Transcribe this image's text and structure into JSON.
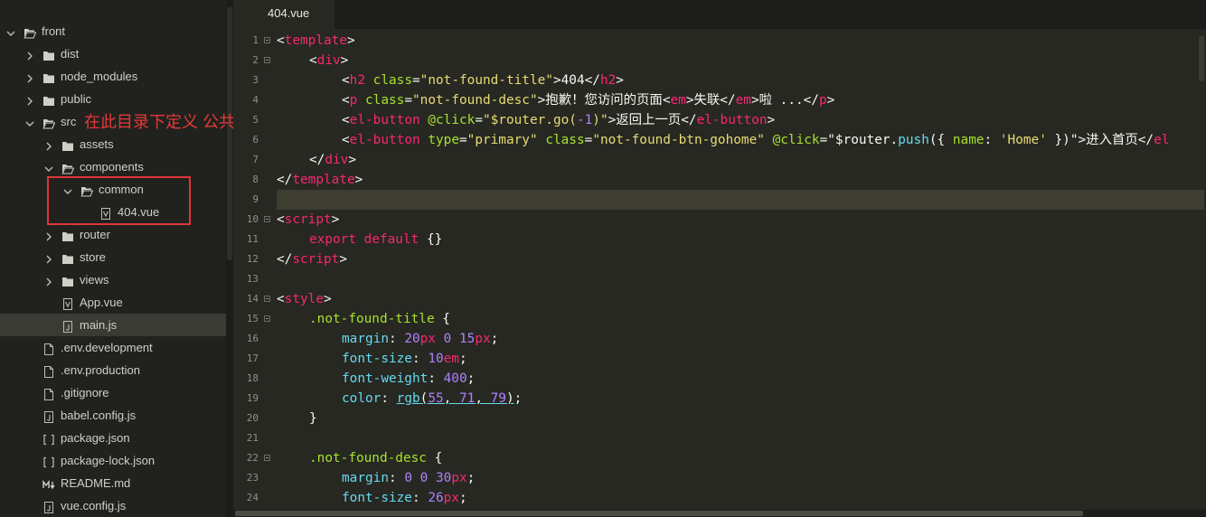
{
  "editor": {
    "tab_label": "404.vue",
    "line_numbers": [
      "1",
      "2",
      "3",
      "4",
      "5",
      "6",
      "7",
      "8",
      "9",
      "10",
      "11",
      "12",
      "13",
      "14",
      "15",
      "16",
      "17",
      "18",
      "19",
      "20",
      "21",
      "22",
      "23",
      "24"
    ]
  },
  "sidebar": {
    "annotation": "在此目录下定义 公共组件",
    "items": [
      {
        "label": "front",
        "icon": "folder-open-icon"
      },
      {
        "label": "dist",
        "icon": "folder-icon"
      },
      {
        "label": "node_modules",
        "icon": "folder-icon"
      },
      {
        "label": "public",
        "icon": "folder-icon"
      },
      {
        "label": "src",
        "icon": "folder-open-icon"
      },
      {
        "label": "assets",
        "icon": "folder-icon"
      },
      {
        "label": "components",
        "icon": "folder-open-icon"
      },
      {
        "label": "common",
        "icon": "folder-open-icon"
      },
      {
        "label": "404.vue",
        "icon": "vue-file-icon"
      },
      {
        "label": "router",
        "icon": "folder-icon"
      },
      {
        "label": "store",
        "icon": "folder-icon"
      },
      {
        "label": "views",
        "icon": "folder-icon"
      },
      {
        "label": "App.vue",
        "icon": "vue-file-icon"
      },
      {
        "label": "main.js",
        "icon": "js-file-icon"
      },
      {
        "label": ".env.development",
        "icon": "file-icon"
      },
      {
        "label": ".env.production",
        "icon": "file-icon"
      },
      {
        "label": ".gitignore",
        "icon": "file-icon"
      },
      {
        "label": "babel.config.js",
        "icon": "js-file-icon"
      },
      {
        "label": "package.json",
        "icon": "json-file-icon"
      },
      {
        "label": "package-lock.json",
        "icon": "json-file-icon"
      },
      {
        "label": "README.md",
        "icon": "markdown-file-icon"
      },
      {
        "label": "vue.config.js",
        "icon": "js-file-icon"
      }
    ]
  },
  "code": {
    "l1": {
      "a": "<",
      "b": "template",
      "c": ">"
    },
    "l2": {
      "a": "<",
      "b": "div",
      "c": ">"
    },
    "l3": {
      "a": "<",
      "b": "h2",
      "c": " ",
      "d": "class",
      "e": "=",
      "f": "\"not-found-title\"",
      "g": ">404</",
      "h": "h2",
      "i": ">"
    },
    "l4": {
      "a": "<",
      "b": "p",
      "c": " ",
      "d": "class",
      "e": "=",
      "f": "\"not-found-desc\"",
      "g": ">抱歉！您访问的页面<",
      "h": "em",
      "i": ">失联</",
      "j": "em",
      "k": ">啦 ...</",
      "l": "p",
      "m": ">"
    },
    "l5": {
      "a": "<",
      "b": "el-button",
      "c": " ",
      "d": "@click",
      "e": "=",
      "f": "\"$router.go(",
      "g": "-1",
      "h": ")\"",
      "i": ">返回上一页</",
      "j": "el-button",
      "k": ">"
    },
    "l6": {
      "a": "<",
      "b": "el-button",
      "c": " ",
      "d": "type",
      "e": "=",
      "f": "\"primary\"",
      "g": " ",
      "h": "class",
      "i": "=",
      "j": "\"not-found-btn-gohome\"",
      "k": " ",
      "l": "@click",
      "m": "=",
      "n": "\"$router.",
      "o": "push",
      "p": "({ ",
      "q": "name",
      "r": ": ",
      "s": "'Home'",
      "t": " })\"",
      "u": ">进入首页</",
      "v": "el"
    },
    "l7": {
      "a": "</",
      "b": "div",
      "c": ">"
    },
    "l8": {
      "a": "</",
      "b": "template",
      "c": ">"
    },
    "l10": {
      "a": "<",
      "b": "script",
      "c": ">"
    },
    "l11": {
      "a": "export default",
      "b": " {}"
    },
    "l12": {
      "a": "</",
      "b": "script",
      "c": ">"
    },
    "l14": {
      "a": "<",
      "b": "style",
      "c": ">"
    },
    "l15": {
      "a": ".not-found-title",
      "b": " {"
    },
    "l16": {
      "a": "margin",
      "b": ": ",
      "c": "20",
      "d": "px",
      "e": " ",
      "f": "0",
      "g": " ",
      "h": "15",
      "i": "px",
      "j": ";"
    },
    "l17": {
      "a": "font-size",
      "b": ": ",
      "c": "10",
      "d": "em",
      "e": ";"
    },
    "l18": {
      "a": "font-weight",
      "b": ": ",
      "c": "400",
      "d": ";"
    },
    "l19": {
      "a": "color",
      "b": ": ",
      "c": "rgb",
      "d": "(",
      "e": "55",
      "f": ", ",
      "g": "71",
      "h": ", ",
      "i": "79",
      "j": ")",
      "k": ";"
    },
    "l20": {
      "a": "}"
    },
    "l22": {
      "a": ".not-found-desc",
      "b": " {"
    },
    "l23": {
      "a": "margin",
      "b": ": ",
      "c": "0",
      "d": " ",
      "e": "0",
      "f": " ",
      "g": "30",
      "h": "px",
      "i": ";"
    },
    "l24": {
      "a": "font-size",
      "b": ": ",
      "c": "26",
      "d": "px",
      "e": ";"
    }
  }
}
